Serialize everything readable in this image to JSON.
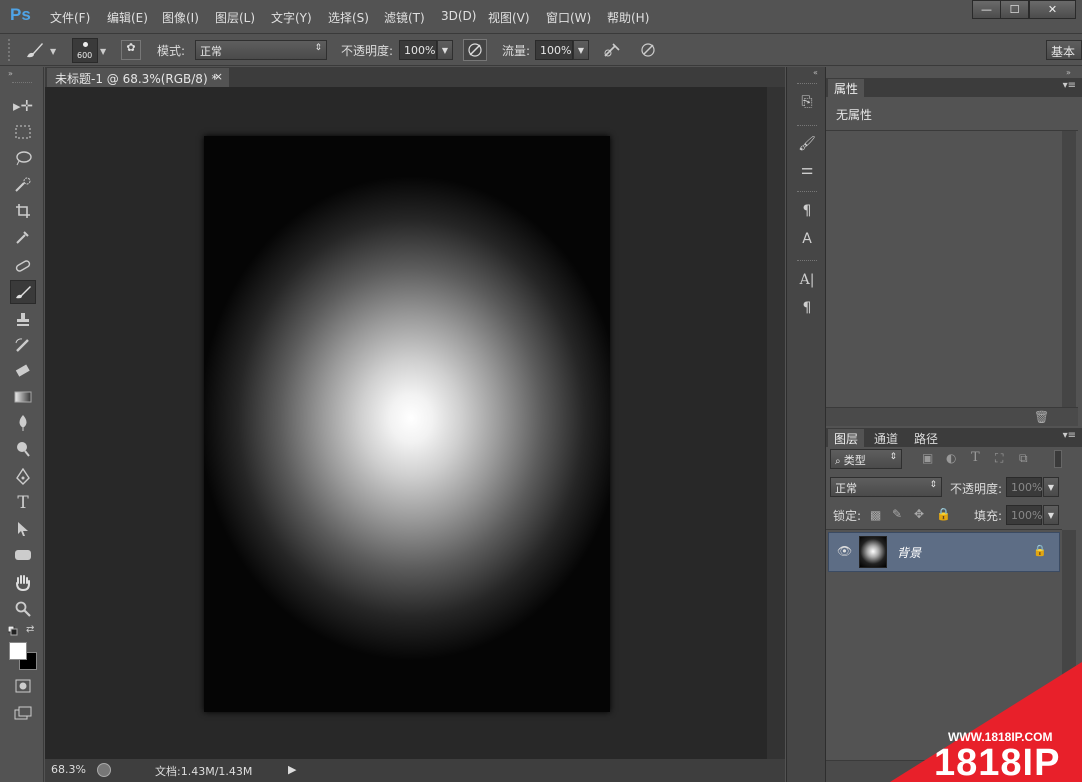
{
  "app": {
    "logo": "Ps"
  },
  "menu": [
    "文件(F)",
    "编辑(E)",
    "图像(I)",
    "图层(L)",
    "文字(Y)",
    "选择(S)",
    "滤镜(T)",
    "3D(D)",
    "视图(V)",
    "窗口(W)",
    "帮助(H)"
  ],
  "window_controls": {
    "minimize": "—",
    "maximize": "☐",
    "close": "✕"
  },
  "options": {
    "brush_size": "600",
    "mode_label": "模式:",
    "mode_value": "正常",
    "opacity_label": "不透明度:",
    "opacity_value": "100%",
    "flow_label": "流量:",
    "flow_value": "100%",
    "workspace": "基本"
  },
  "document": {
    "tab_title": "未标题-1 @ 68.3%(RGB/8) *",
    "tab_close": "×",
    "zoom": "68.3%",
    "doc_info": "文档:1.43M/1.43M"
  },
  "properties": {
    "title": "属性",
    "content": "无属性"
  },
  "layers_panel": {
    "tabs": [
      "图层",
      "通道",
      "路径"
    ],
    "filter_label": "类型",
    "blend_mode": "正常",
    "opacity_label": "不透明度:",
    "opacity_value": "100%",
    "lock_label": "锁定:",
    "fill_label": "填充:",
    "fill_value": "100%",
    "layers": [
      {
        "name": "背景"
      }
    ]
  },
  "watermark": {
    "url": "WWW.1818IP.COM",
    "brand": "1818IP"
  },
  "colors": {
    "ui_bg": "#535353",
    "canvas_bg": "#282828",
    "layer_selected": "#5d6d85",
    "ps_blue": "#4fa3e6",
    "watermark_red": "#e8202a"
  }
}
